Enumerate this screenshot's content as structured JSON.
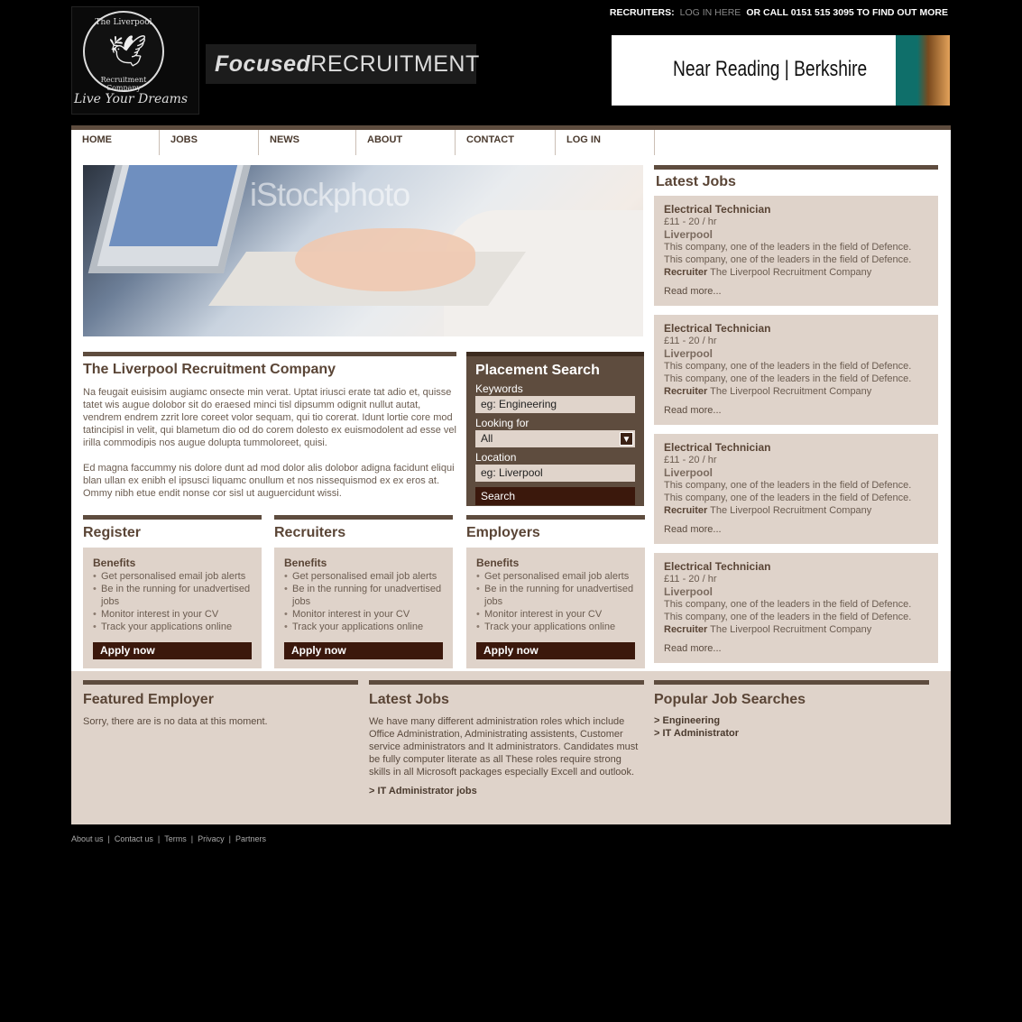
{
  "header": {
    "logo": {
      "ring_top": "The Liverpool",
      "ring_bottom": "Recruitment Company",
      "tagline": "Live Your Dreams"
    },
    "brand": {
      "bold": "Focused",
      "rest": "RECRUITMENT"
    },
    "topbar": {
      "recruiters_label": "RECRUITERS:",
      "login_link": "LOG IN HERE",
      "call_text": "OR CALL 0151 515 3095 TO FIND OUT MORE"
    },
    "banner": {
      "text": "Near Reading | Berkshire"
    }
  },
  "nav": {
    "items": [
      {
        "label": "HOME"
      },
      {
        "label": "JOBS"
      },
      {
        "label": "NEWS"
      },
      {
        "label": "ABOUT"
      },
      {
        "label": "CONTACT"
      },
      {
        "label": "LOG IN"
      }
    ]
  },
  "hero": {
    "watermark": "iStockphoto"
  },
  "about": {
    "title": "The Liverpool Recruitment Company",
    "para1": "Na feugait euisisim augiamc onsecte min verat. Uptat iriusci erate tat adio et, quisse tatet wis augue dolobor sit do eraesed minci tisl dipsumm odignit nullut autat, vendrem endrem zzrit lore coreet volor sequam, qui tio corerat. Idunt lortie core mod tatincipisl in velit, qui blametum dio od do corem dolesto ex euismodolent ad esse vel irilla commodipis nos augue dolupta tummoloreet, quisi.",
    "para2": "Ed magna faccummy nis dolore dunt ad mod dolor alis dolobor adigna facidunt eliqui blan ullan ex enibh el ipsusci liquamc onullum et nos nissequismod ex ex eros at. Ommy nibh etue endit nonse cor sisl ut auguercidunt wissi."
  },
  "search": {
    "title": "Placement Search",
    "keywords_label": "Keywords",
    "keywords_placeholder": "eg: Engineering",
    "looking_label": "Looking for",
    "looking_value": "All",
    "location_label": "Location",
    "location_placeholder": "eg: Liverpool",
    "button": "Search"
  },
  "columns": [
    {
      "title": "Register",
      "benefits_title": "Benefits",
      "apply": "Apply now",
      "benefits": [
        "Get personalised email job alerts",
        "Be in the running for unadvertised jobs",
        "Monitor interest in your CV",
        "Track your applications online"
      ]
    },
    {
      "title": "Recruiters",
      "benefits_title": "Benefits",
      "apply": "Apply now",
      "benefits": [
        "Get personalised email job alerts",
        "Be in the running for unadvertised jobs",
        "Monitor interest in your CV",
        "Track your applications online"
      ]
    },
    {
      "title": "Employers",
      "benefits_title": "Benefits",
      "apply": "Apply now",
      "benefits": [
        "Get personalised email job alerts",
        "Be in the running for unadvertised jobs",
        "Monitor interest in your CV",
        "Track your applications online"
      ]
    }
  ],
  "latest_jobs": {
    "title": "Latest Jobs",
    "jobs": [
      {
        "title": "Electrical Technician",
        "rate": "£11 - 20 / hr",
        "location": "Liverpool",
        "desc1": "This company, one of the leaders in the field of Defence.",
        "desc2": "This company, one of the leaders in the field of Defence.",
        "recruiter_label": "Recruiter",
        "recruiter": "The Liverpool Recruitment Company",
        "more": "Read more..."
      },
      {
        "title": "Electrical Technician",
        "rate": "£11 - 20 / hr",
        "location": "Liverpool",
        "desc1": "This company, one of the leaders in the field of Defence.",
        "desc2": "This company, one of the leaders in the field of Defence.",
        "recruiter_label": "Recruiter",
        "recruiter": "The Liverpool Recruitment Company",
        "more": "Read more..."
      },
      {
        "title": "Electrical Technician",
        "rate": "£11 - 20 / hr",
        "location": "Liverpool",
        "desc1": "This company, one of the leaders in the field of Defence.",
        "desc2": "This company, one of the leaders in the field of Defence.",
        "recruiter_label": "Recruiter",
        "recruiter": "The Liverpool Recruitment Company",
        "more": "Read more..."
      },
      {
        "title": "Electrical Technician",
        "rate": "£11 - 20 / hr",
        "location": "Liverpool",
        "desc1": "This company, one of the leaders in the field of Defence.",
        "desc2": "This company, one of the leaders in the field of Defence.",
        "recruiter_label": "Recruiter",
        "recruiter": "The Liverpool Recruitment Company",
        "more": "Read more..."
      }
    ]
  },
  "footer_panels": {
    "featured": {
      "title": "Featured Employer",
      "text": "Sorry, there are is no data at this moment."
    },
    "latest": {
      "title": "Latest Jobs",
      "text": "We have many different administration roles which include Office Administration, Administrating assistents, Customer service administrators and It administrators. Candidates must be fully computer literate as all These roles require strong skills in all Microsoft packages especially Excell and outlook.",
      "link": "> IT Administrator jobs"
    },
    "popular": {
      "title": "Popular Job Searches",
      "links": [
        "> Engineering",
        "> IT Administrator"
      ]
    }
  },
  "footer_links": [
    "About us",
    "Contact us",
    "Terms",
    "Privacy",
    "Partners"
  ],
  "colors": {
    "brown": "#5e4c3e",
    "dark_brown": "#3b180c",
    "beige": "#dfd3ca"
  }
}
